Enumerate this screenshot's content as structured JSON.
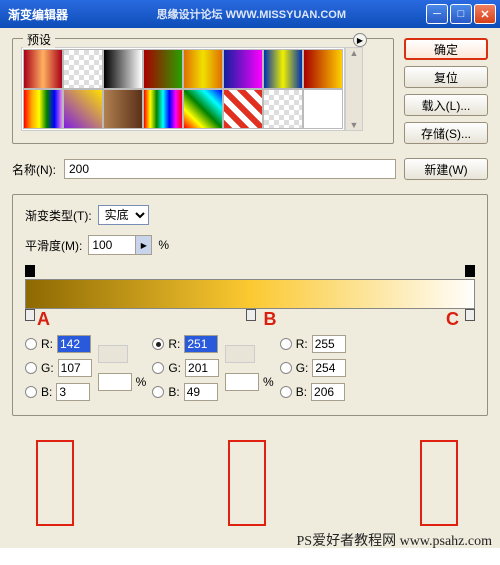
{
  "titlebar": {
    "title": "渐变编辑器",
    "watermark": "思缘设计论坛  WWW.MISSYUAN.COM"
  },
  "presets_label": "预设",
  "buttons": {
    "ok": "确定",
    "reset": "复位",
    "load": "载入(L)...",
    "save": "存储(S)...",
    "new": "新建(W)"
  },
  "name": {
    "label": "名称(N):",
    "value": "200"
  },
  "gradtype": {
    "label": "渐变类型(T):",
    "value": "实底"
  },
  "smoothness": {
    "label": "平滑度(M):",
    "value": "100",
    "unit": "%"
  },
  "rgb": {
    "A": {
      "r": "142",
      "g": "107",
      "b": "3"
    },
    "B": {
      "r": "251",
      "g": "201",
      "b": "49"
    },
    "C": {
      "r": "255",
      "g": "254",
      "b": "206"
    }
  },
  "labels": {
    "R": "R:",
    "G": "G:",
    "B": "B:",
    "pct": "%"
  },
  "ann": {
    "A": "A",
    "B": "B",
    "C": "C"
  },
  "footer_watermark": "PS爱好者教程网  www.psahz.com",
  "swatches": [
    "linear-gradient(90deg,#a80018,#ffb060,#a80018)",
    "repeating-conic-gradient(#fff 0 25%,#ddd 0 50%) 0 0/10px 10px",
    "linear-gradient(90deg,#000,#fff)",
    "linear-gradient(90deg,#a80000,#2aa000)",
    "linear-gradient(90deg,#e07000,#f0e000,#e07000)",
    "linear-gradient(90deg,#1020a0,#ff00ff)",
    "linear-gradient(90deg,#0030b0,#f0f000,#0030b0)",
    "linear-gradient(90deg,#a80000,#ffd000)",
    "linear-gradient(90deg,red,orange,yellow,green,blue,violet)",
    "linear-gradient(45deg,#8020e0,#ffe000)",
    "linear-gradient(90deg,#b08050,#5a3018)",
    "linear-gradient(90deg,red,yellow,green,cyan,blue,magenta,red)",
    "linear-gradient(45deg,red,yellow,green,cyan,blue)",
    "repeating-linear-gradient(45deg,#e03020 0 6px,#fff 6px 12px)",
    "repeating-conic-gradient(#fff 0 25%,#ddd 0 50%) 0 0/10px 10px",
    "#fff"
  ]
}
